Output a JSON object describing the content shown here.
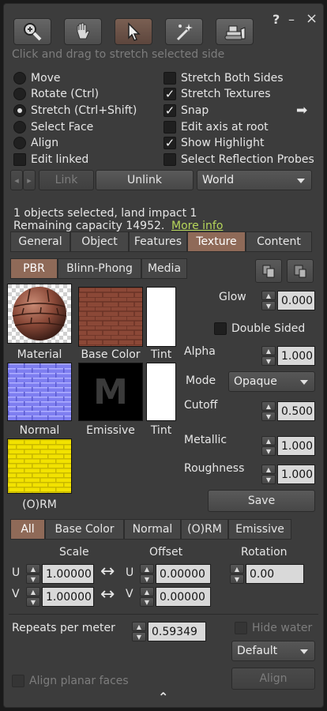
{
  "window": {
    "help_glyph": "?",
    "minimize_glyph": "–",
    "close_glyph": "×"
  },
  "toolbar": {
    "hint": "Click and drag to stretch selected side",
    "tools": [
      {
        "icon": "zoom-icon"
      },
      {
        "icon": "grab-hand-icon"
      },
      {
        "icon": "pointer-icon"
      },
      {
        "icon": "build-wand-icon"
      },
      {
        "icon": "bulldozer-icon"
      }
    ]
  },
  "edit_modes": {
    "move": "Move",
    "rotate": "Rotate (Ctrl)",
    "stretch": "Stretch (Ctrl+Shift)",
    "select_face": "Select Face",
    "align": "Align",
    "edit_linked": "Edit linked",
    "selected": "stretch"
  },
  "options": {
    "stretch_both": {
      "label": "Stretch Both Sides",
      "checked": false
    },
    "stretch_textures": {
      "label": "Stretch Textures",
      "checked": true
    },
    "snap": {
      "label": "Snap",
      "checked": true
    },
    "edit_axis": {
      "label": "Edit axis at root",
      "checked": false
    },
    "show_highlight": {
      "label": "Show Highlight",
      "checked": true
    },
    "reflection_probes": {
      "label": "Select Reflection Probes",
      "checked": false
    },
    "check_glyph": "✓",
    "snap_arrow": "➡"
  },
  "link_row": {
    "link": "Link",
    "unlink": "Unlink",
    "coord_system": "World",
    "prev_glyph": "◂",
    "next_glyph": "▸"
  },
  "selection_info": {
    "line1": "1 objects selected, land impact 1",
    "line2": "Remaining capacity 14952.",
    "more_info": "More info"
  },
  "main_tabs": [
    "General",
    "Object",
    "Features",
    "Texture",
    "Content"
  ],
  "main_tab_active": "Texture",
  "material_tabs": [
    "PBR",
    "Blinn-Phong",
    "Media"
  ],
  "material_tab_active": "PBR",
  "swatches": {
    "material": "Material",
    "base_color": "Base Color",
    "tint1": "Tint",
    "normal": "Normal",
    "emissive": "Emissive",
    "tint2": "Tint",
    "orm": "(O)RM",
    "emissive_letter": "M"
  },
  "props": {
    "glow_label": "Glow",
    "glow": "0.000",
    "double_sided": "Double Sided",
    "alpha_label": "Alpha",
    "alpha": "1.000",
    "mode_label": "Mode",
    "mode": "Opaque",
    "cutoff_label": "Cutoff",
    "cutoff": "0.500",
    "metallic_label": "Metallic",
    "metallic": "1.000",
    "roughness_label": "Roughness",
    "roughness": "1.000",
    "save": "Save"
  },
  "map_tabs": [
    "All",
    "Base Color",
    "Normal",
    "(O)RM",
    "Emissive"
  ],
  "map_tab_active": "All",
  "transform": {
    "scale_header": "Scale",
    "offset_header": "Offset",
    "rotation_header": "Rotation",
    "u": "U",
    "v": "V",
    "scale_u": "1.00000",
    "scale_v": "1.00000",
    "offset_u": "0.00000",
    "offset_v": "0.00000",
    "rotation": "0.00",
    "flip_glyph": "↔"
  },
  "bottom": {
    "repeats_label": "Repeats per meter",
    "repeats": "0.59349",
    "hide_water": "Hide water",
    "default_dropdown": "Default",
    "align_planar": "Align planar faces",
    "align_button": "Align",
    "collapse_glyph": "⌃"
  },
  "colors": {
    "accent_tab": "#8f6a58",
    "link_green": "#b6d65a",
    "panel_bg": "#3c3c3c"
  }
}
